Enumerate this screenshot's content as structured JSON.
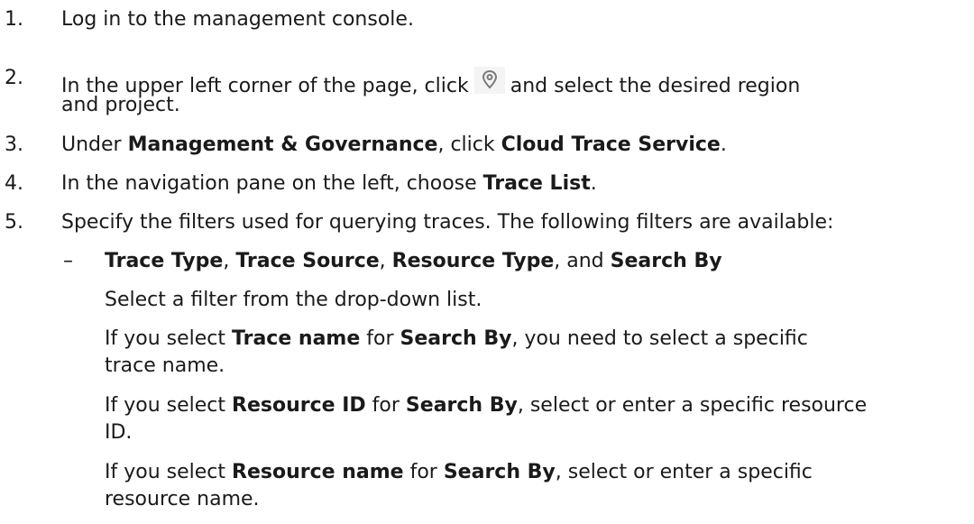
{
  "steps": [
    {
      "num": "1.",
      "text": "Log in to the management console."
    },
    {
      "num": "2.",
      "pre": "In the upper left corner of the page, click",
      "post": "and select the desired region",
      "cont": "and project.",
      "icon": "location-pin-icon"
    },
    {
      "num": "3.",
      "pre": "Under ",
      "b1": "Management & Governance",
      "mid": ", click ",
      "b2": "Cloud Trace Service",
      "post": "."
    },
    {
      "num": "4.",
      "pre": "In the navigation pane on the left, choose ",
      "b1": "Trace List",
      "post": "."
    },
    {
      "num": "5.",
      "text": "Specify the filters used for querying traces. The following filters are available:"
    }
  ],
  "sub": {
    "dash": "–",
    "title": {
      "b1": "Trace Type",
      "s1": ", ",
      "b2": "Trace Source",
      "s2": ", ",
      "b3": "Resource Type",
      "s3": ", and ",
      "b4": "Search By"
    },
    "p1": "Select a filter from the drop-down list.",
    "p2": {
      "pre": "If you select ",
      "b1": "Trace name",
      "mid": " for ",
      "b2": "Search By",
      "post": ", you need to select a specific",
      "cont": "trace name."
    },
    "p3": {
      "pre": "If you select ",
      "b1": "Resource ID",
      "mid": " for ",
      "b2": "Search By",
      "post": ", select or enter a specific resource",
      "cont": "ID."
    },
    "p4": {
      "pre": "If you select ",
      "b1": "Resource name",
      "mid": " for ",
      "b2": "Search By",
      "post": ", select or enter a specific",
      "cont": "resource name."
    }
  }
}
